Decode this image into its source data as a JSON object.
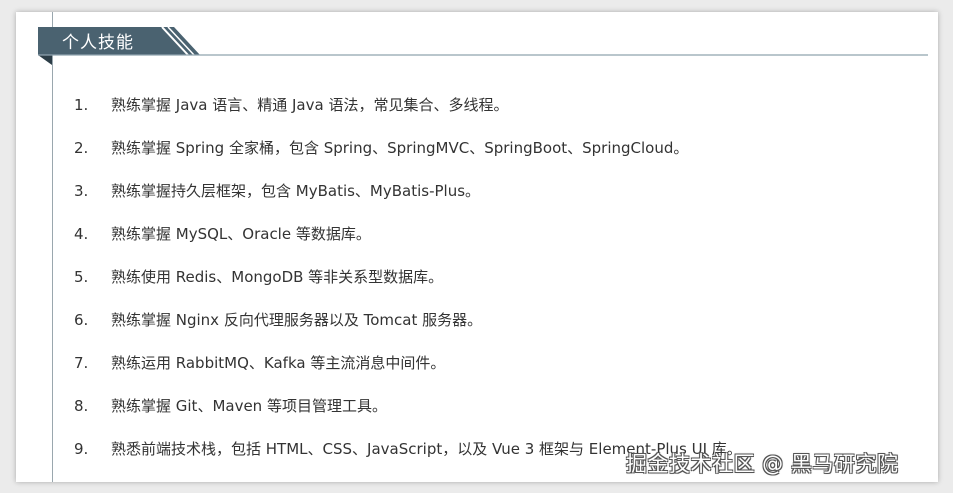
{
  "section": {
    "title": "个人技能"
  },
  "skills": [
    {
      "num": "1.",
      "text": "熟练掌握 Java 语言、精通 Java 语法，常见集合、多线程。"
    },
    {
      "num": "2.",
      "text": "熟练掌握 Spring 全家桶，包含 Spring、SpringMVC、SpringBoot、SpringCloud。"
    },
    {
      "num": "3.",
      "text": "熟练掌握持久层框架，包含 MyBatis、MyBatis-Plus。"
    },
    {
      "num": "4.",
      "text": "熟练掌握 MySQL、Oracle 等数据库。"
    },
    {
      "num": "5.",
      "text": "熟练使用 Redis、MongoDB 等非关系型数据库。"
    },
    {
      "num": "6.",
      "text": "熟练掌握 Nginx 反向代理服务器以及 Tomcat 服务器。"
    },
    {
      "num": "7.",
      "text": "熟练运用 RabbitMQ、Kafka 等主流消息中间件。"
    },
    {
      "num": "8.",
      "text": "熟练掌握 Git、Maven 等项目管理工具。"
    },
    {
      "num": "9.",
      "text": "熟悉前端技术栈，包括 HTML、CSS、JavaScript，以及 Vue 3 框架与 Element-Plus UI 库。"
    }
  ],
  "watermark": "掘金技术社区 @ 黑马研究院",
  "colors": {
    "header_tab": "#4a6270",
    "header_fold": "#2c3d47",
    "rule": "#8fa3ae",
    "text": "#333333"
  }
}
